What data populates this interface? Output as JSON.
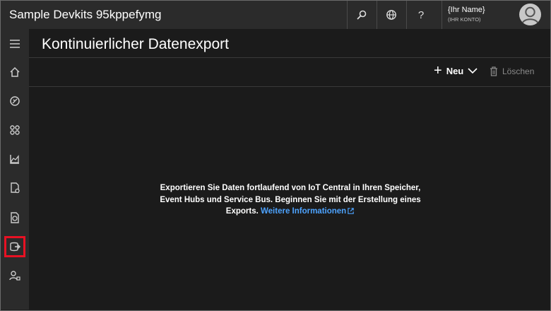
{
  "app": {
    "title": "Sample Devkits 95kppefymg"
  },
  "header": {
    "user_name": "{Ihr Name}",
    "user_account": "(IHR KONTO)"
  },
  "page": {
    "title": "Kontinuierlicher Datenexport"
  },
  "toolbar": {
    "new_label": "Neu",
    "delete_label": "Löschen"
  },
  "empty_state": {
    "text_line1": "Exportieren Sie Daten fortlaufend von IoT Central in Ihren Speicher,",
    "text_line2": "Event Hubs und Service Bus. Beginnen Sie mit der Erstellung eines",
    "text_line3": "Exports.",
    "link": "Weitere Informationen"
  },
  "sidebar": {
    "items": [
      {
        "icon": "menu-icon"
      },
      {
        "icon": "home-icon"
      },
      {
        "icon": "devices-icon"
      },
      {
        "icon": "device-groups-icon"
      },
      {
        "icon": "analytics-icon"
      },
      {
        "icon": "jobs-icon"
      },
      {
        "icon": "device-templates-icon"
      },
      {
        "icon": "data-export-icon",
        "active": true
      },
      {
        "icon": "administration-icon"
      }
    ]
  },
  "colors": {
    "active_outline": "#e81123",
    "link": "#4da3ff"
  }
}
